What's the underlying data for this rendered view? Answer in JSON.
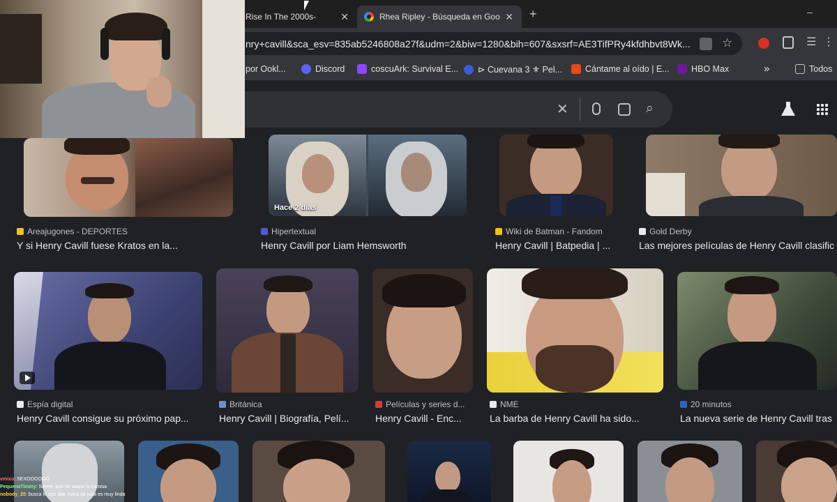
{
  "tabs": [
    {
      "title": "Rise In The 2000s-"
    },
    {
      "title": "Rhea Ripley - Búsqueda en Goo"
    }
  ],
  "new_tab_symbol": "+",
  "window_minimize": "–",
  "address": {
    "url": "nry+cavill&sca_esv=835ab5246808a27f&udm=2&biw=1280&bih=607&sxsrf=AE3TifPRy4kfdhbvt8Wk..."
  },
  "bookmarks": [
    {
      "label": "por Ookl...",
      "color": "#5f6368"
    },
    {
      "label": "Discord",
      "color": "#5865f2"
    },
    {
      "label": "coscuArk: Survival E...",
      "color": "#9146ff"
    },
    {
      "label": "⊳ Cuevana 3 ⚜ Pel...",
      "color": "#3b5bdb"
    },
    {
      "label": "Cántame al oído | E...",
      "color": "#e8491d"
    },
    {
      "label": "HBO Max",
      "color": "#6a1b9a"
    },
    {
      "label": "»",
      "color": ""
    },
    {
      "label": "Todos",
      "color": "#e8eaed"
    }
  ],
  "results_row1": [
    {
      "source": "Areajugones - DEPORTES",
      "title": "Y si Henry Cavill fuese Kratos en la...",
      "fav_color": "#e6c229"
    },
    {
      "source": "Hipertextual",
      "title": "Henry Cavill por Liam Hemsworth",
      "badge": "Hace 2 días",
      "fav_color": "#4f5bd5"
    },
    {
      "source": "Wiki de Batman - Fandom",
      "title": "Henry Cavill | Batpedia | ...",
      "fav_color": "#f2c300"
    },
    {
      "source": "Gold Derby",
      "title": "Las mejores películas de Henry Cavill clasific",
      "fav_color": "#e8eaed"
    }
  ],
  "results_row2": [
    {
      "source": "Espía digital",
      "title": "Henry Cavill consigue su próximo pap...",
      "fav_color": "#e8eaed"
    },
    {
      "source": "Británica",
      "title": "Henry Cavill | Biografía, Pelí...",
      "fav_color": "#6d8fc8"
    },
    {
      "source": "Películas y series d...",
      "title": "Henry Cavill - Enc...",
      "fav_color": "#d23c3c"
    },
    {
      "source": "NME",
      "title": "La barba de Henry Cavill ha sido...",
      "fav_color": "#e8eaed"
    },
    {
      "source": "20 minutos",
      "title": "La nueva serie de Henry Cavill tras",
      "fav_color": "#2f62c7"
    }
  ],
  "chat": [
    {
      "user": "vmixo",
      "text": "SEXOOOOOO"
    },
    {
      "user": "PequenaTimmy",
      "text": "Seeee, que se saque la camisa"
    },
    {
      "user": "nobody_20",
      "text": "busca lo que dije, fuera de joda es muy linda"
    }
  ]
}
